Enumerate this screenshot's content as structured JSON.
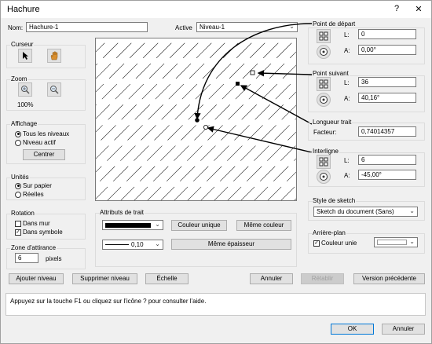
{
  "window": {
    "title": "Hachure",
    "help_glyph": "?",
    "close_glyph": "✕"
  },
  "name": {
    "label": "Nom:",
    "value": "Hachure-1"
  },
  "active": {
    "label": "Active",
    "value": "Niveau-1"
  },
  "cursor": {
    "title": "Curseur"
  },
  "zoom": {
    "title": "Zoom",
    "value": "100%"
  },
  "display": {
    "title": "Affichage",
    "options": [
      "Tous les niveaux",
      "Niveau actif"
    ],
    "selected": 0,
    "center_label": "Centrer"
  },
  "units": {
    "title": "Unités",
    "options": [
      "Sur papier",
      "Réelles"
    ],
    "selected": 0
  },
  "rotation": {
    "title": "Rotation",
    "checks": [
      {
        "label": "Dans mur",
        "checked": false
      },
      {
        "label": "Dans symbole",
        "checked": true
      }
    ]
  },
  "snap": {
    "title": "Zone d'attirance",
    "value": "6",
    "unit": "pixels"
  },
  "start_point": {
    "title": "Point de départ",
    "l_label": "L:",
    "l_value": "0",
    "a_label": "A:",
    "a_value": "0,00°"
  },
  "next_point": {
    "title": "Point suivant",
    "l_label": "L:",
    "l_value": "36",
    "a_label": "A:",
    "a_value": "40,16°"
  },
  "stroke_length": {
    "title": "Longueur trait",
    "factor_label": "Facteur:",
    "factor_value": "0,74014357"
  },
  "spacing": {
    "title": "Interligne",
    "l_label": "L:",
    "l_value": "6",
    "a_label": "A:",
    "a_value": "-45,00°"
  },
  "sketch_style": {
    "title": "Style de sketch",
    "value": "Sketch du document (Sans)"
  },
  "background": {
    "title": "Arrière-plan",
    "check_label": "Couleur unie",
    "checked": true
  },
  "line_attrs": {
    "title": "Attributs de trait",
    "thickness": "0,10",
    "unique_color": "Couleur unique",
    "same_color": "Même couleur",
    "same_thickness": "Même épaisseur"
  },
  "bottom_buttons": {
    "add_level": "Ajouter niveau",
    "delete_level": "Supprimer niveau",
    "scale": "Échelle",
    "cancel": "Annuler",
    "redo": "Rétablir",
    "previous": "Version précédente"
  },
  "help": {
    "text": "Appuyez sur la touche F1 ou cliquez sur l'icône ? pour consulter l'aide."
  },
  "footer": {
    "ok": "OK",
    "cancel": "Annuler"
  },
  "colors": {
    "accent": "#0078d7",
    "line_color": "#000000"
  }
}
